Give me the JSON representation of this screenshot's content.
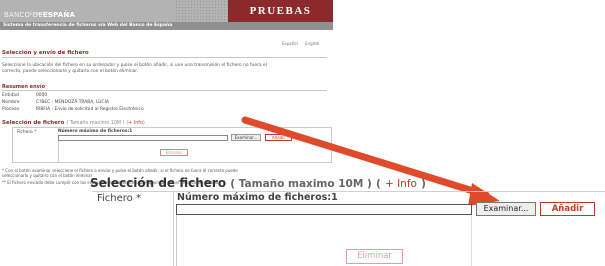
{
  "header": {
    "logo_part1": "BANCO DE",
    "logo_part2": "ESPAÑA",
    "logo_sub": "Eurosistema",
    "env_badge": "PRUEBAS",
    "system_title": "Sistema de transferencia de ficheros vía Web del Banco de España",
    "lang_es": "Español",
    "lang_en": "English"
  },
  "page": {
    "title": "Selección y envío de fichero",
    "intro_line1": "Seleccione la ubicación del fichero en su ordenador y pulse el botón añadir, si une una transmisión el fichero no fuera el",
    "intro_line2": "correcto, puede seleccionarlo y quitarlo con el botón eliminar."
  },
  "summary": {
    "heading": "Resumen envío",
    "rows": [
      {
        "label": "Entidad",
        "value": "0000"
      },
      {
        "label": "Nombre",
        "value": "C?BEC - MENDOZA TRABA, LUCIA"
      },
      {
        "label": "Proceso",
        "value": "IRBFIA - Envío de solicitud al Registro Electrónico"
      }
    ]
  },
  "selection": {
    "title": "Selección de fichero",
    "size_note": "( Tamaño maximo 10M )",
    "info_open": "(",
    "info_link": "+ Info",
    "info_close": ")",
    "fichero_label": "Fichero *",
    "max_files": "Número máximo de ficheros:1",
    "browse_label": "Examinar...",
    "add_label": "Añadir",
    "remove_label": "Eliminar",
    "note1": "* Con el botón examinar seleccione el fichero a enviar y pulse el botón añadir, si el fichero no fuera el correcto puede",
    "note1b": "seleccionarlo y quitarlo con el botón eliminar",
    "note2": "** El fichero enviado debe cumplir con las especificaciones de formato requeridas por el proceso de destino"
  },
  "colors": {
    "brand_red": "#8b2a2a",
    "accent_red": "#c0392b",
    "arrow": "#e04a2a",
    "header_gray": "#b3b3b3"
  }
}
